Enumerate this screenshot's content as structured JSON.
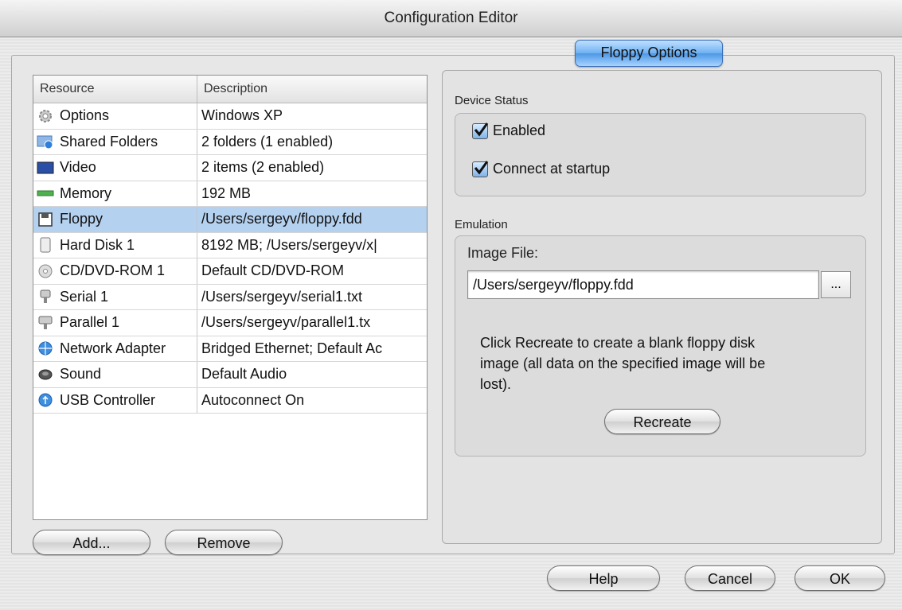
{
  "window": {
    "title": "Configuration Editor"
  },
  "table": {
    "headers": [
      "Resource",
      "Description"
    ],
    "rows": [
      {
        "icon": "gear-icon",
        "resource": "Options",
        "description": "Windows XP",
        "selected": false
      },
      {
        "icon": "shared-folders-icon",
        "resource": "Shared Folders",
        "description": "2 folders (1 enabled)",
        "selected": false
      },
      {
        "icon": "video-icon",
        "resource": "Video",
        "description": "2 items (2 enabled)",
        "selected": false
      },
      {
        "icon": "memory-icon",
        "resource": "Memory",
        "description": "192 MB",
        "selected": false
      },
      {
        "icon": "floppy-icon",
        "resource": "Floppy",
        "description": "/Users/sergeyv/floppy.fdd",
        "selected": true
      },
      {
        "icon": "hard-disk-icon",
        "resource": "Hard Disk 1",
        "description": "8192 MB; /Users/sergeyv/x|",
        "selected": false
      },
      {
        "icon": "cd-icon",
        "resource": "CD/DVD-ROM 1",
        "description": "Default CD/DVD-ROM",
        "selected": false
      },
      {
        "icon": "serial-port-icon",
        "resource": "Serial 1",
        "description": "/Users/sergeyv/serial1.txt",
        "selected": false
      },
      {
        "icon": "parallel-port-icon",
        "resource": "Parallel 1",
        "description": "/Users/sergeyv/parallel1.tx",
        "selected": false
      },
      {
        "icon": "network-icon",
        "resource": "Network Adapter",
        "description": "Bridged Ethernet; Default Ac",
        "selected": false
      },
      {
        "icon": "sound-icon",
        "resource": "Sound",
        "description": "Default Audio",
        "selected": false
      },
      {
        "icon": "usb-icon",
        "resource": "USB Controller",
        "description": "Autoconnect On",
        "selected": false
      }
    ]
  },
  "list_buttons": {
    "add": "Add...",
    "remove": "Remove"
  },
  "options": {
    "tab_label": "Floppy Options",
    "device_status": {
      "label": "Device Status",
      "enabled_label": "Enabled",
      "enabled_checked": true,
      "connect_label": "Connect at startup",
      "connect_checked": true
    },
    "emulation": {
      "label": "Emulation",
      "image_file_label": "Image File:",
      "image_file_value": "/Users/sergeyv/floppy.fdd",
      "browse_label": "...",
      "info_text_line1": "Click Recreate to create a blank floppy disk",
      "info_text_line2": "image (all data on the specified image will be",
      "info_text_line3": "lost).",
      "recreate_label": "Recreate"
    }
  },
  "dialog_buttons": {
    "help": "Help",
    "cancel": "Cancel",
    "ok": "OK"
  },
  "colors": {
    "selection": "#b5d1f0",
    "accent_tab": "#6eb0f2"
  }
}
